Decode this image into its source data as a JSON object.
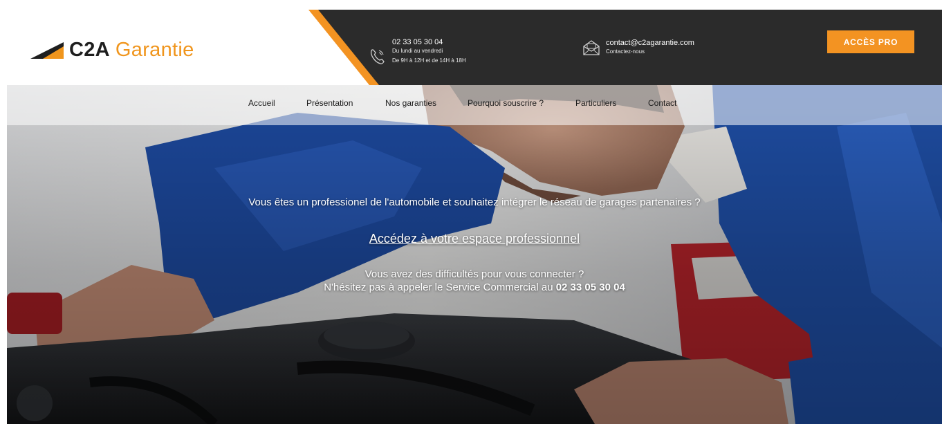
{
  "brand": {
    "name_part1": "C2A",
    "name_part2": "Garantie",
    "accent_color": "#f39322",
    "dark_color": "#2b2b2b"
  },
  "header": {
    "phone": {
      "icon": "phone-icon",
      "number": "02 33 05 30 04",
      "hours_line1": "Du lundi au vendredi",
      "hours_line2": "De 9H à 12H et de 14H à 18H"
    },
    "email": {
      "icon": "envelope-icon",
      "address": "contact@c2agarantie.com",
      "subtitle": "Contactez-nous"
    },
    "pro_button_label": "ACCÈS PRO"
  },
  "nav": {
    "items": [
      {
        "label": "Accueil"
      },
      {
        "label": "Présentation"
      },
      {
        "label": "Nos garanties"
      },
      {
        "label": "Pourquoi souscrire ?"
      },
      {
        "label": "Particuliers"
      },
      {
        "label": "Contact"
      }
    ]
  },
  "hero": {
    "question": "Vous êtes un professionel de l'automobile et souhaitez intégrer le réseau de garages partenaires ?",
    "link_label": "Accédez à votre espace professionnel",
    "help_line1": "Vous avez des difficultés pour vous connecter ?",
    "help_line2_prefix": "N'hésitez pas à appeler le Service Commercial au ",
    "help_line2_phone": "02 33 05 30 04"
  }
}
